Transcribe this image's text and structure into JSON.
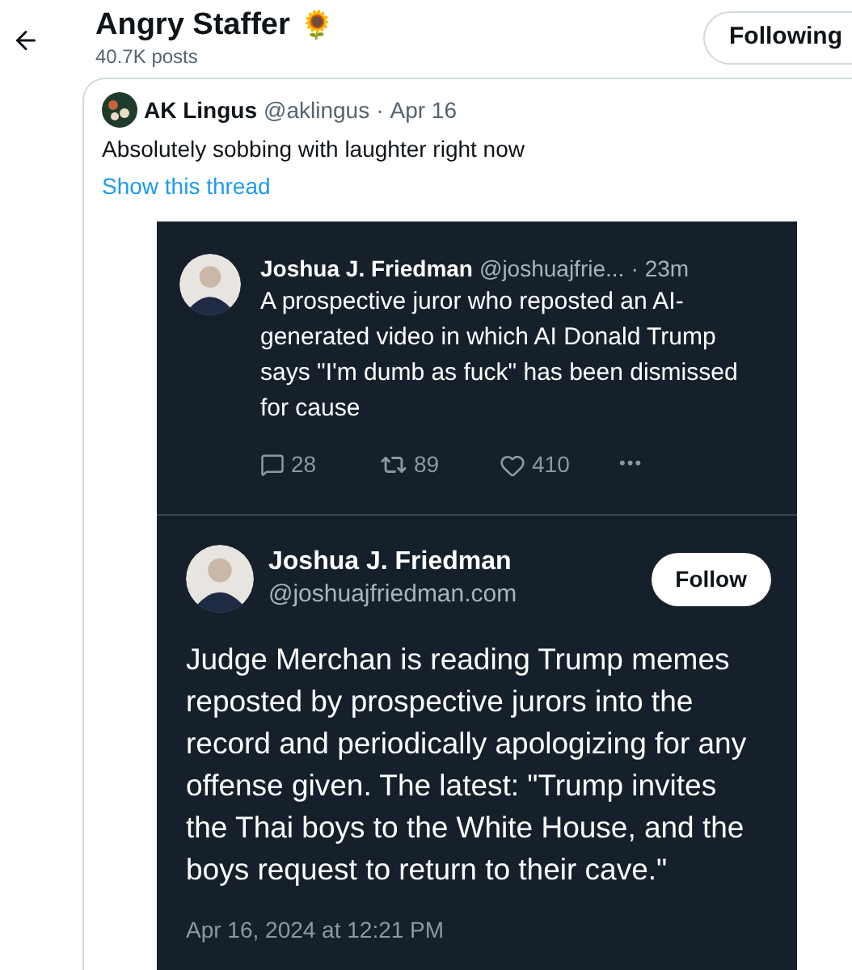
{
  "header": {
    "title": "Angry Staffer",
    "emoji": "🌻",
    "subtitle": "40.7K posts",
    "follow_button": {
      "label": "Following",
      "following": true
    }
  },
  "quote": {
    "name": "AK Lingus",
    "handle": "@aklingus",
    "separator": "·",
    "time": "Apr 16",
    "text": "Absolutely sobbing with laughter right now",
    "link": "Show this thread"
  },
  "embedded_screenshot": {
    "reply": {
      "name": "Joshua J. Friedman",
      "handle": "@joshuajfrie...",
      "separator": "·",
      "time": "23m",
      "text": "A prospective juror who reposted an AI-generated video in which AI Donald Trump says \"I'm dumb as fuck\" has been dismissed for cause",
      "actions": [
        {
          "kind": "reply",
          "count": "28"
        },
        {
          "kind": "repost",
          "count": "89"
        },
        {
          "kind": "like",
          "count": "410"
        },
        {
          "kind": "more",
          "count": "•••"
        }
      ]
    },
    "post": {
      "name": "Joshua J. Friedman",
      "handle": "@joshuajfriedman.com",
      "follow_label": "Follow",
      "text": "Judge Merchan is reading Trump memes reposted by prospective jurors into the record and periodically apologizing for any offense given. The latest: \"Trump invites the Thai boys to the White House, and the boys request to return to their cave.\"",
      "timestamp": "Apr 16, 2024 at 12:21 PM"
    }
  }
}
